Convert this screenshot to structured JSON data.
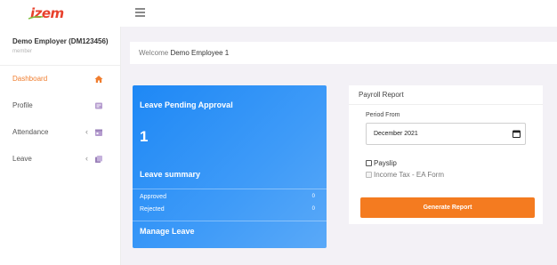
{
  "brand": {
    "logo_text": "izem",
    "color": "#e8412c",
    "accent": "#f07d2e"
  },
  "header": {
    "menu_icon": "hamburger-icon"
  },
  "user": {
    "name": "Demo Employer (DM123456)",
    "role": "member"
  },
  "sidebar": {
    "items": [
      {
        "label": "Dashboard",
        "icon": "home-icon",
        "active": true
      },
      {
        "label": "Profile",
        "icon": "profile-icon"
      },
      {
        "label": "Attendance",
        "icon": "calendar-icon",
        "has_submenu": true
      },
      {
        "label": "Leave",
        "icon": "copy-icon",
        "has_submenu": true
      }
    ],
    "chevron": "‹"
  },
  "welcome": {
    "prefix": "Welcome",
    "name": "Demo Employee 1"
  },
  "leave_card": {
    "title": "Leave Pending Approval",
    "count": "1",
    "summary_title": "Leave summary",
    "rows": [
      {
        "label": "Approved",
        "value": "0"
      },
      {
        "label": "Rejected",
        "value": "0"
      }
    ],
    "manage_label": "Manage Leave"
  },
  "payroll": {
    "title": "Payroll Report",
    "period_label": "Period From",
    "period_value": "December 2021",
    "options": [
      {
        "label": "Payslip",
        "enabled": true,
        "checked": false
      },
      {
        "label": "Income Tax - EA Form",
        "enabled": false,
        "checked": false
      }
    ],
    "button_label": "Generate Report",
    "button_color": "#f47b20"
  }
}
